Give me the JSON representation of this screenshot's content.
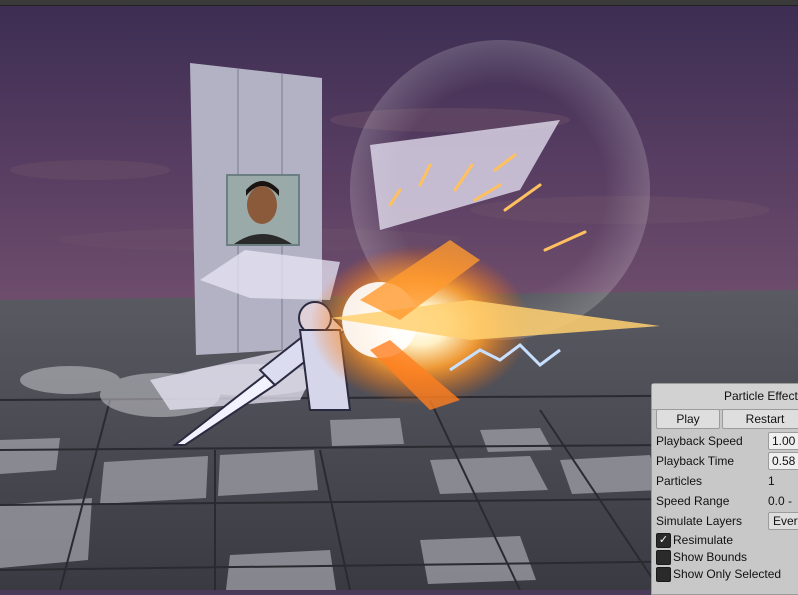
{
  "panel": {
    "title": "Particle Effect",
    "play_label": "Play",
    "restart_label": "Restart",
    "playback_speed": {
      "label": "Playback Speed",
      "value": "1.00"
    },
    "playback_time": {
      "label": "Playback Time",
      "value": "0.58"
    },
    "particles": {
      "label": "Particles",
      "value": "1"
    },
    "speed_range": {
      "label": "Speed Range",
      "value": "0.0 -"
    },
    "simulate_layers": {
      "label": "Simulate Layers",
      "value": "Everything"
    },
    "resimulate": {
      "label": "Resimulate",
      "checked": true,
      "mark": "✓"
    },
    "show_bounds": {
      "label": "Show Bounds",
      "checked": false
    },
    "show_only_selected": {
      "label": "Show Only Selected",
      "checked": false
    }
  },
  "colors": {
    "sky_top": "#3f2f55",
    "sky_bottom": "#6b4a6e",
    "floor_dark": "#3e3e46",
    "floor_light": "#8c8c94",
    "effect_core": "#fff6e0",
    "effect_orange": "#ff8a1a",
    "lightning": "#b8d8ff"
  }
}
